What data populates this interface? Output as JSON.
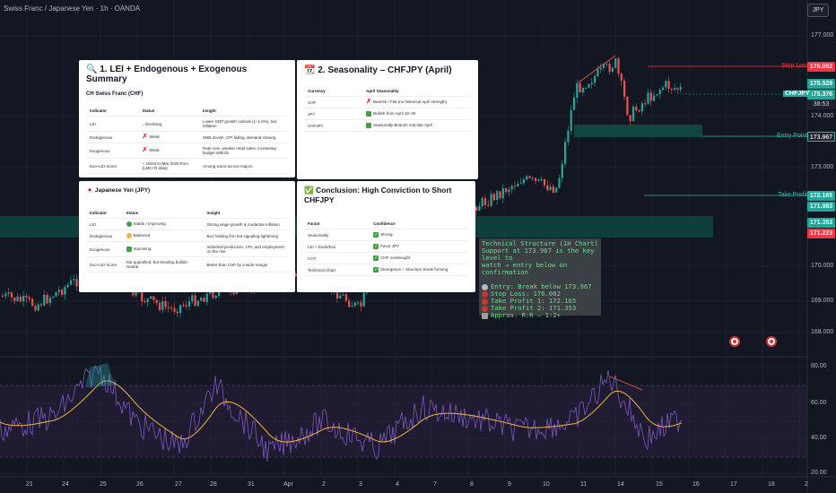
{
  "header": {
    "symbol_title": "Swiss Franc / Japanese Yen · 1h · OANDA",
    "currency_badge": "JPY"
  },
  "price_axis": [
    "177.000",
    "176.000",
    "174.000",
    "173.000",
    "172.000",
    "171.000",
    "170.000",
    "169.000",
    "168.000"
  ],
  "rsi_axis": [
    "80.00",
    "60.00",
    "40.00",
    "20.00"
  ],
  "time_axis": [
    "21",
    "24",
    "25",
    "26",
    "27",
    "28",
    "31",
    "Apr",
    "2",
    "3",
    "4",
    "7",
    "8",
    "9",
    "10",
    "11",
    "14",
    "15",
    "16",
    "17",
    "18",
    "2"
  ],
  "levels": {
    "stop_loss": {
      "label": "Stop Loss",
      "price": "176.082",
      "color": "#f23645"
    },
    "entry": {
      "label": "Entry Point",
      "price": "173.967",
      "color": "#2bb5a8"
    },
    "take_profit": {
      "label": "Take Profit",
      "price": "172.165",
      "color": "#2bb5a8"
    },
    "tp_extra": {
      "price": "171.983"
    },
    "zone_top": {
      "price": "171.353"
    },
    "zone_bottom": {
      "price": "171.223"
    },
    "high_tag": {
      "price": "175.528"
    },
    "current": {
      "symbol": "CHFJPY",
      "price": "175.376",
      "countdown": "38:53"
    }
  },
  "panel1": {
    "title": "🔍 1. LEI + Endogenous + Exogenous Summary",
    "subtitle": "CH Swiss Franc (CHF)",
    "headers": [
      "Indicator",
      "Status",
      "Insight"
    ],
    "rows": [
      [
        "LEI",
        "↓ Declining",
        "Lower GDP growth outlook (1–1.5%), low inflation"
      ],
      [
        "Endogenous",
        "Weak",
        "SNB dovish, CPI falling, demand slowing"
      ],
      [
        "Exogenous",
        "Weak",
        "Rate cuts, weaker retail sales, increasing budget deficits"
      ],
      [
        "Exo+LEI Score",
        "~ 1MA5.5 (Mar 2025 from (LMCI R data)",
        "Among worst across majors"
      ]
    ]
  },
  "panel2": {
    "title": "🇯🇵 Japanese Yen (JPY)",
    "headers": [
      "Indicator",
      "Status",
      "Insight"
    ],
    "rows": [
      [
        "LEI",
        "Stable / Improving",
        "Strong wage growth & moderate inflation"
      ],
      [
        "Endogenous",
        "Balanced",
        "BoJ holding firm but signaling tightening"
      ],
      [
        "Exogenous",
        "Improving",
        "Industrial production, CPI, and employment on the rise"
      ],
      [
        "Exo+LEI Score",
        "Not quantified, but trending bullish-neutral",
        "Better than CHF by a wide margin"
      ]
    ]
  },
  "panel3": {
    "title": "📆 2. Seasonality – CHFJPY (April)",
    "headers": [
      "Currency",
      "April Seasonality"
    ],
    "rows": [
      [
        "CHF",
        "Bearish / Flat (no historical April strength)"
      ],
      [
        "JPY",
        "Bullish from April 15–30"
      ],
      [
        "CHFJPY",
        "Seasonally Bearish mid-late April"
      ]
    ]
  },
  "panel4": {
    "title": "✅ Conclusion: High Conviction to Short CHFJPY",
    "headers": [
      "Factor",
      "Confidence"
    ],
    "rows": [
      [
        "Seasonality",
        "Strong"
      ],
      [
        "LEI + Endo/Exo",
        "Favor JPY"
      ],
      [
        "COT",
        "CHF overbought"
      ],
      [
        "Technical Chart",
        "Divergence + Structure break forming"
      ]
    ]
  },
  "textbox": {
    "lines_top": [
      "Technical Structure (1H Chart)",
      "Support at 173.967 is the key level to",
      "watch → entry below on confirmation"
    ],
    "lines_bottom": [
      "Entry: Break below 173.967",
      "Stop Loss: 176.082",
      "Take Profit 1: 172.165",
      "Take Profit 2: 171.353",
      "Approx. R:R – 1:2+"
    ]
  },
  "colors": {
    "bull": "#26a69a",
    "bear": "#ef5350",
    "rsi": "#7e57c2",
    "rsi_ma": "#f0b73a",
    "zone": "#0f4d44"
  }
}
